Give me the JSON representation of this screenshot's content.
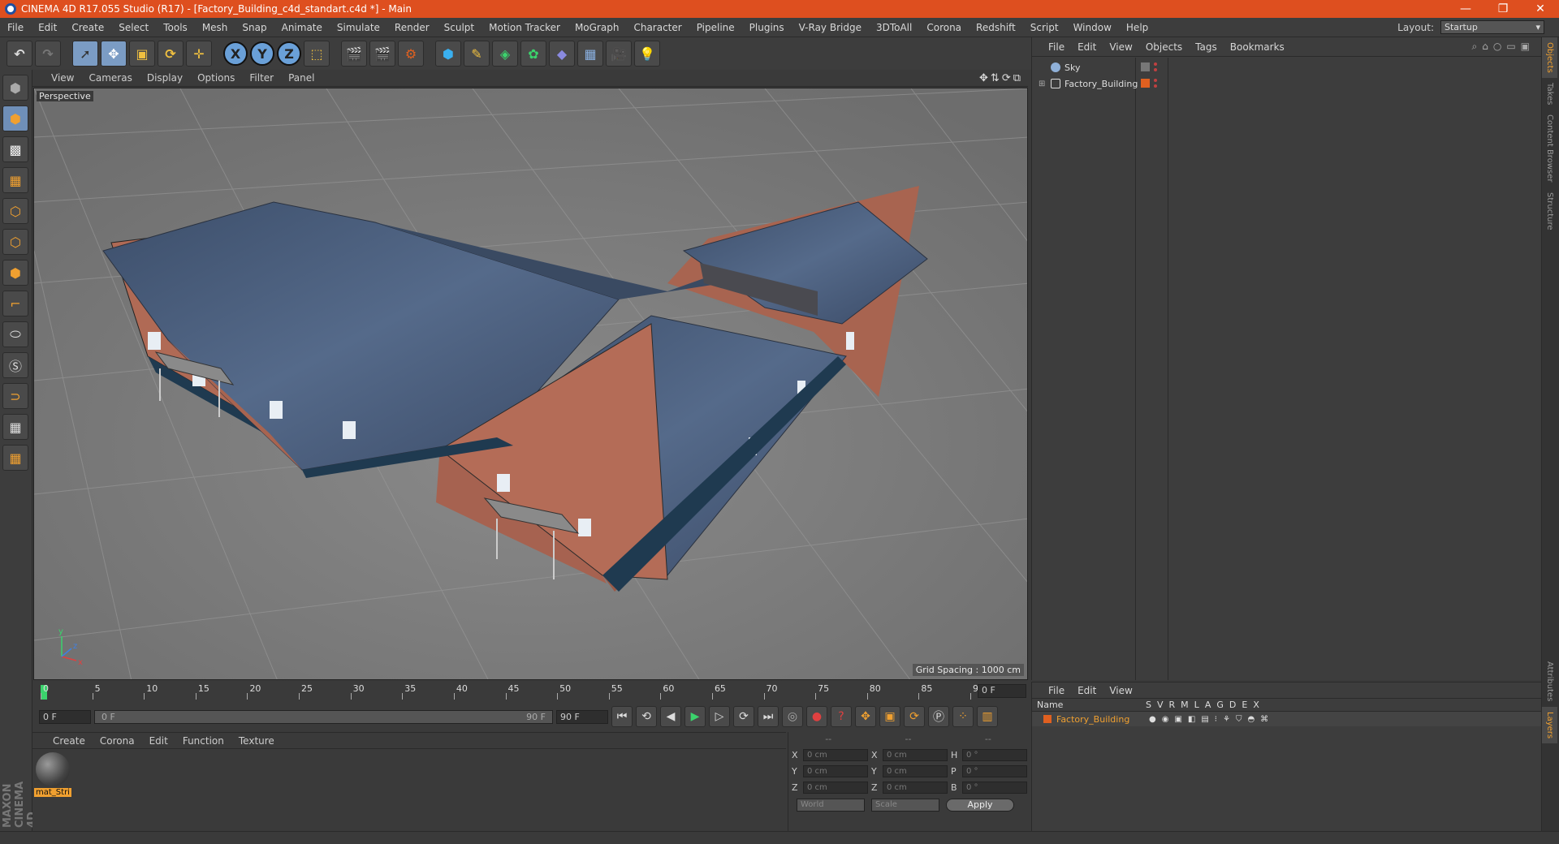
{
  "titlebar": {
    "title": "CINEMA 4D R17.055 Studio (R17) - [Factory_Building_c4d_standart.c4d *] - Main",
    "minimize": "—",
    "restore": "❐",
    "close": "✕"
  },
  "menubar": {
    "items": [
      "File",
      "Edit",
      "Create",
      "Select",
      "Tools",
      "Mesh",
      "Snap",
      "Animate",
      "Simulate",
      "Render",
      "Sculpt",
      "Motion Tracker",
      "MoGraph",
      "Character",
      "Pipeline",
      "Plugins",
      "V-Ray Bridge",
      "3DToAll",
      "Corona",
      "Redshift",
      "Script",
      "Window",
      "Help"
    ],
    "layout_label": "Layout:",
    "layout_value": "Startup"
  },
  "toolbar": {
    "axis_x": "X",
    "axis_y": "Y",
    "axis_z": "Z"
  },
  "viewport": {
    "menu": [
      "View",
      "Cameras",
      "Display",
      "Options",
      "Filter",
      "Panel"
    ],
    "label": "Perspective",
    "grid_spacing": "Grid Spacing : 1000 cm",
    "axis_y": "y",
    "axis_x": "x",
    "axis_z": "z"
  },
  "timeline": {
    "ticks": [
      "0",
      "5",
      "10",
      "15",
      "20",
      "25",
      "30",
      "35",
      "40",
      "45",
      "50",
      "55",
      "60",
      "65",
      "70",
      "75",
      "80",
      "85",
      "90"
    ],
    "current_frame": "0 F"
  },
  "transport": {
    "start_frame": "0 F",
    "range_start": "0 F",
    "range_end": "90 F",
    "end_frame": "90 F"
  },
  "material_manager": {
    "menu": [
      "Create",
      "Corona",
      "Edit",
      "Function",
      "Texture"
    ],
    "material_name": "mat_Stri"
  },
  "attributes": {
    "headers": [
      "--",
      "--",
      "--"
    ],
    "rows": [
      {
        "k1": "X",
        "v1": "0 cm",
        "k2": "X",
        "v2": "0 cm",
        "k3": "H",
        "v3": "0 °"
      },
      {
        "k1": "Y",
        "v1": "0 cm",
        "k2": "Y",
        "v2": "0 cm",
        "k3": "P",
        "v3": "0 °"
      },
      {
        "k1": "Z",
        "v1": "0 cm",
        "k2": "Z",
        "v2": "0 cm",
        "k3": "B",
        "v3": "0 °"
      }
    ],
    "coord_mode": "World",
    "transform_mode": "Scale",
    "apply": "Apply"
  },
  "object_manager": {
    "menu": [
      "File",
      "Edit",
      "View",
      "Objects",
      "Tags",
      "Bookmarks"
    ],
    "objects": [
      {
        "name": "Sky"
      },
      {
        "name": "Factory_Building"
      }
    ]
  },
  "side_tabs": [
    "Objects",
    "Takes",
    "Content Browser",
    "Structure",
    "Attributes",
    "Layers"
  ],
  "layer_manager": {
    "menu": [
      "File",
      "Edit",
      "View"
    ],
    "name_header": "Name",
    "columns": [
      "S",
      "V",
      "R",
      "M",
      "L",
      "A",
      "G",
      "D",
      "E",
      "X"
    ],
    "layer_name": "Factory_Building"
  },
  "branding": {
    "logo": "MAXON CINEMA 4D"
  },
  "colors": {
    "title_accent": "#de4f1f",
    "selection_orange": "#f0a030",
    "playhead_green": "#3bd36c"
  }
}
